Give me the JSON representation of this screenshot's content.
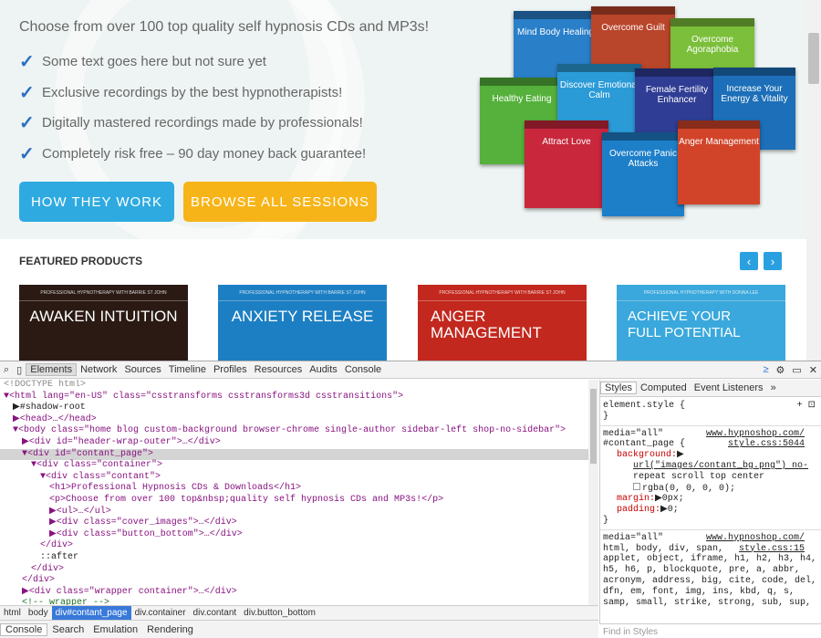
{
  "site": {
    "tagline": "Choose from over 100 top quality self hypnosis CDs and MP3s!",
    "bullets": [
      "Some text goes here but not sure yet",
      "Exclusive recordings by the best hypnotherapists!",
      "Digitally mastered recordings made by professionals!",
      "Completely risk free – 90 day money back guarantee!"
    ],
    "btn_how": "HOW THEY WORK",
    "btn_browse": "BROWSE ALL SESSIONS",
    "covers": [
      "Mind Body Healing",
      "Overcome Guilt",
      "Overcome Agoraphobia",
      "Healthy Eating",
      "Discover Emotional Calm",
      "Female Fertility Enhancer",
      "Increase Your Energy & Vitality",
      "Attract Love",
      "Overcome Panic Attacks",
      "Anger Management"
    ],
    "featured_title": "FEATURED PRODUCTS",
    "arrow_prev": "‹",
    "arrow_next": "›",
    "products": [
      {
        "header": "PROFESSIONAL HYPNOTHERAPY WITH BARRIE ST JOHN",
        "title": "AWAKEN INTUITION",
        "color": "#2b1a14"
      },
      {
        "header": "PROFESSIONAL HYPNOTHERAPY WITH BARRIE ST JOHN",
        "title": "ANXIETY RELEASE",
        "color": "#1d7fc3"
      },
      {
        "header": "PROFESSIONAL HYPNOTHERAPY WITH BARRIE ST JOHN",
        "title": "ANGER MANAGEMENT",
        "color": "#c2281e"
      },
      {
        "header": "PROFESSIONAL HYPNOTHERAPY WITH DONNA LEE",
        "title": "ACHIEVE YOUR FULL POTENTIAL",
        "color": "#3aa8dc"
      }
    ],
    "colors": {
      "btn_how": "#2eaae1",
      "btn_browse": "#f7b418",
      "accent": "#2a6fc4"
    }
  },
  "devtools": {
    "tabs": [
      "Elements",
      "Network",
      "Sources",
      "Timeline",
      "Profiles",
      "Resources",
      "Audits",
      "Console"
    ],
    "elements": [
      {
        "i": 0,
        "t": "<!DOCTYPE html>",
        "c": "gr"
      },
      {
        "i": 0,
        "t": "▼<html lang=\"en-US\" class=\"csstransforms csstransforms3d csstransitions\">",
        "c": ""
      },
      {
        "i": 1,
        "t": "▶#shadow-root",
        "c": "tx"
      },
      {
        "i": 1,
        "t": "▶<head>…</head>",
        "c": ""
      },
      {
        "i": 1,
        "t": "▼<body class=\"home blog custom-background browser-chrome single-author sidebar-left shop-no-sidebar\">",
        "c": ""
      },
      {
        "i": 2,
        "t": "▶<div id=\"header-wrap-outer\">…</div>",
        "c": ""
      },
      {
        "i": 2,
        "t": "▼<div id=\"contant_page\">",
        "c": "",
        "sel": true
      },
      {
        "i": 3,
        "t": "▼<div class=\"container\">",
        "c": ""
      },
      {
        "i": 4,
        "t": "▼<div class=\"contant\">",
        "c": ""
      },
      {
        "i": 5,
        "t": "<h1>Professional Hypnosis CDs & Downloads</h1>",
        "c": ""
      },
      {
        "i": 5,
        "t": "<p>Choose from over 100 top&nbsp;quality self hypnosis CDs and MP3s!</p>",
        "c": ""
      },
      {
        "i": 5,
        "t": "▶<ul>…</ul>",
        "c": ""
      },
      {
        "i": 5,
        "t": "▶<div class=\"cover_images\">…</div>",
        "c": ""
      },
      {
        "i": 5,
        "t": "▶<div class=\"button_bottom\">…</div>",
        "c": ""
      },
      {
        "i": 4,
        "t": "</div>",
        "c": ""
      },
      {
        "i": 4,
        "t": "::after",
        "c": "tx"
      },
      {
        "i": 3,
        "t": "</div>",
        "c": ""
      },
      {
        "i": 2,
        "t": "</div>",
        "c": ""
      },
      {
        "i": 2,
        "t": "▶<div class=\"wrapper container\">…</div>",
        "c": ""
      },
      {
        "i": 2,
        "t": "<!-- wrapper -->",
        "c": "cm"
      }
    ],
    "breadcrumbs": [
      "html",
      "body",
      "div#contant_page",
      "div.container",
      "div.contant",
      "div.button_bottom"
    ],
    "drawer_tabs": [
      "Console",
      "Search",
      "Emulation",
      "Rendering"
    ],
    "styles_tabs": [
      "Styles",
      "Computed",
      "Event Listeners",
      "»"
    ],
    "styles": {
      "element_style": "element.style {",
      "close": "}",
      "media": "media=\"all\"",
      "src1": "www.hypnoshop.com/",
      "src1b": "style.css:5044",
      "rule1_sel": "#contant_page {",
      "bg_prop": "background:",
      "bg_val1": "url(\"images/contant_bg.png\") no-",
      "bg_val2": "repeat scroll top center",
      "bg_val3": "rgba(0, 0, 0, 0);",
      "margin": "margin:",
      "margin_val": "▶0px;",
      "padding": "padding:",
      "padding_val": "▶0;",
      "src2": "www.hypnoshop.com/",
      "src2b": "style.css:15",
      "reset_lines": [
        "html, body, div, span,",
        "applet, object, iframe, h1, h2, h3, h4,",
        "h5, h6, p, blockquote, pre, a, abbr,",
        "acronym, address, big, cite, code, del,",
        "dfn, em, font, img, ins, kbd, q, s,",
        "samp, small, strike, strong, sub, sup,"
      ]
    },
    "find_placeholder": "Find in Styles"
  }
}
